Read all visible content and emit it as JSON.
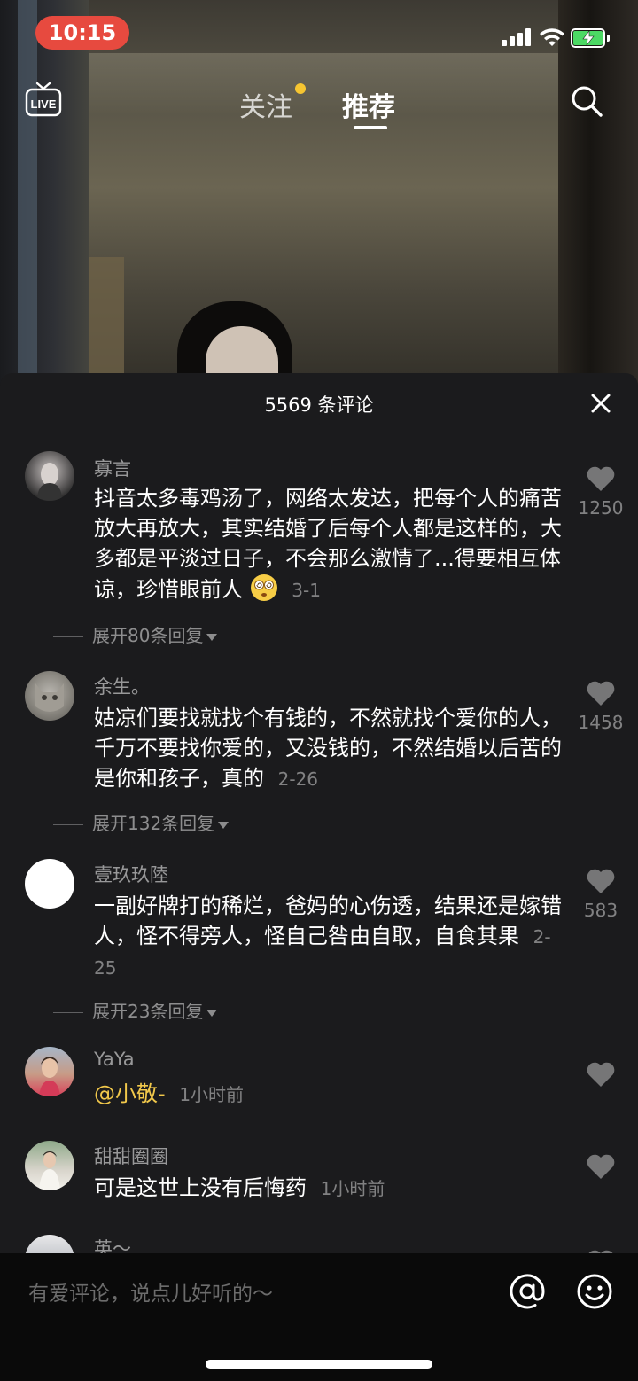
{
  "status_bar": {
    "time": "10:15",
    "battery_color": "#4cd964",
    "time_pill_color": "#e74a3f"
  },
  "top_nav": {
    "live_icon": "live-tv-icon",
    "tabs": [
      {
        "label": "关注",
        "active": false,
        "has_dot": true
      },
      {
        "label": "推荐",
        "active": true
      }
    ],
    "search_icon": "search-icon"
  },
  "comments_panel": {
    "title": "5569 条评论",
    "close_icon": "close-icon",
    "comments": [
      {
        "user": "寡言",
        "text": "抖音太多毒鸡汤了，网络太发达，把每个人的痛苦放大再放大，其实结婚了后每个人都是这样的，大多都是平淡过日子，不会那么激情了...得要相互体谅，珍惜眼前人",
        "emoji": "dazed-face-emoji",
        "time": "3-1",
        "likes": "1250",
        "expand_label": "展开80条回复"
      },
      {
        "user": "余生。",
        "text": "姑凉们要找就找个有钱的，不然就找个爱你的人，千万不要找你爱的，又没钱的，不然结婚以后苦的是你和孩子，真的",
        "time": "2-26",
        "likes": "1458",
        "expand_label": "展开132条回复"
      },
      {
        "user": "壹玖玖陸",
        "text": "一副好牌打的稀烂，爸妈的心伤透，结果还是嫁错人，怪不得旁人，怪自己咎由自取，自食其果",
        "time": "2-25",
        "likes": "583",
        "expand_label": "展开23条回复"
      },
      {
        "user": "YaYa",
        "mention": "@小敬-",
        "time": "1小时前"
      },
      {
        "user": "甜甜圈圈",
        "text": "可是这世上没有后悔药",
        "time": "1小时前"
      },
      {
        "user": "英～"
      }
    ]
  },
  "input_bar": {
    "placeholder": "有爱评论，说点儿好听的～",
    "at_icon": "at-icon",
    "emoji_icon": "smiley-icon"
  },
  "colors": {
    "panel_bg": "#1b1b1d",
    "mention": "#f1c84b",
    "follow_dot": "#f6c531"
  }
}
